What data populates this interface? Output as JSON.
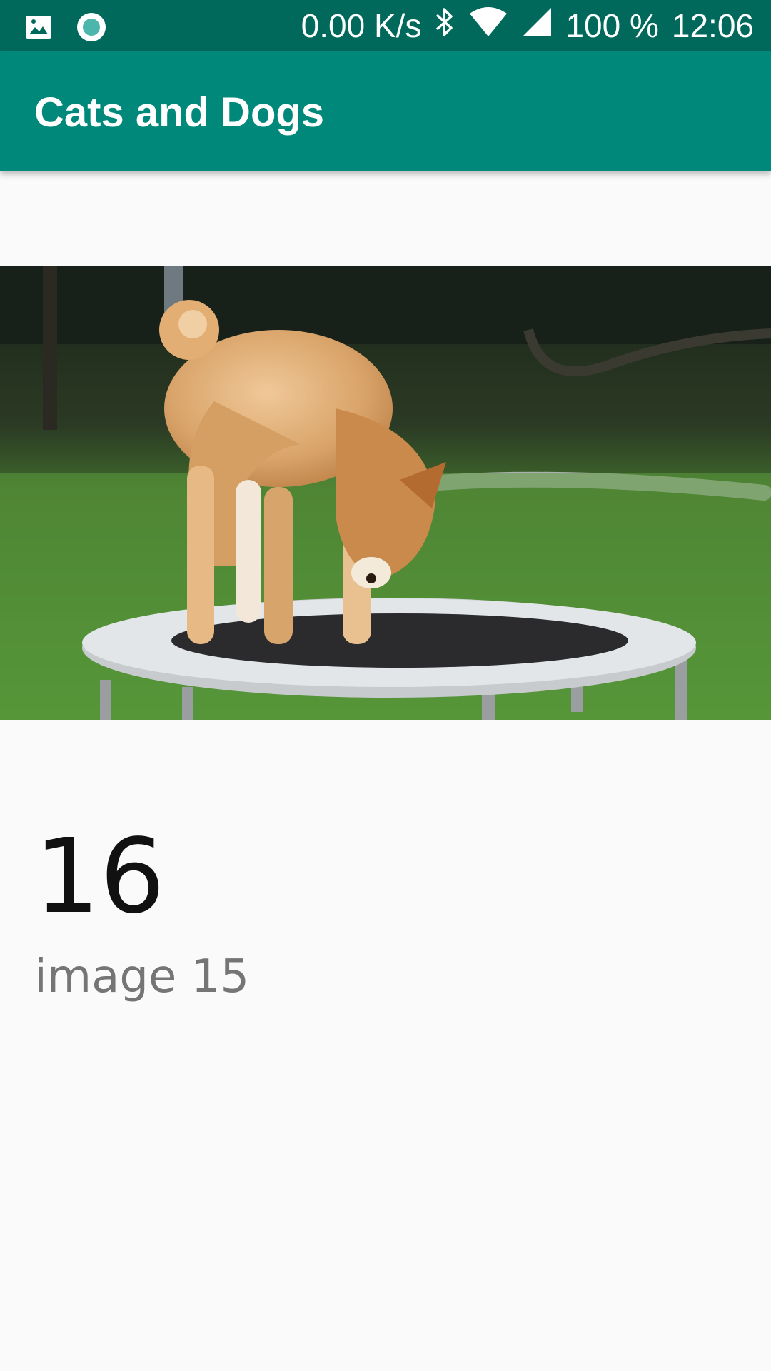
{
  "status_bar": {
    "net_speed": "0.00 K/s",
    "battery": "100 %",
    "time": "12:06",
    "icons": [
      "image-icon",
      "circle-dot-icon",
      "bluetooth-icon",
      "wifi-icon",
      "signal-icon"
    ]
  },
  "app_bar": {
    "title": "Cats and Dogs"
  },
  "content": {
    "number": "16",
    "caption": "image 15",
    "photo_subject": "dog-on-trampoline"
  },
  "colors": {
    "status_bar": "#00695c",
    "app_bar": "#00897b",
    "background": "#fafafa"
  }
}
